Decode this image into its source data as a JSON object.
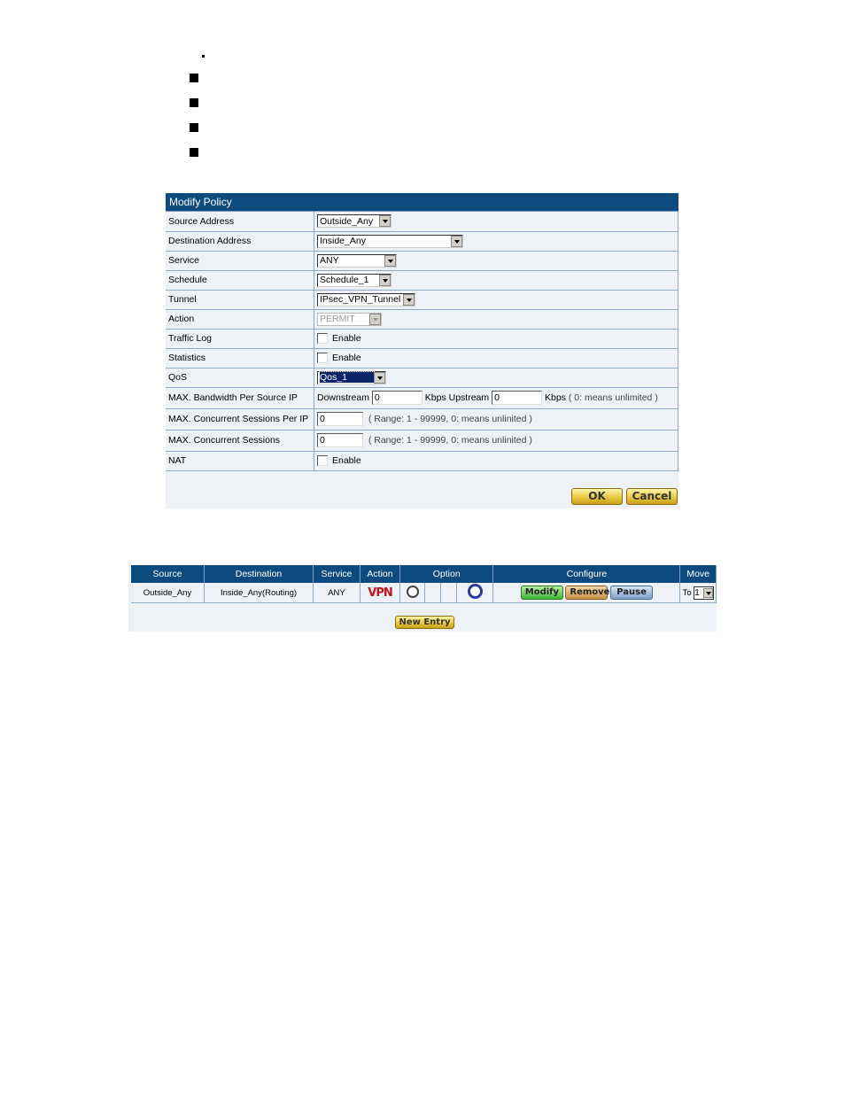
{
  "bullets_count": 4,
  "modify_policy": {
    "title": "Modify Policy",
    "rows": [
      {
        "label": "Source Address",
        "type": "select",
        "value": "Outside_Any"
      },
      {
        "label": "Destination Address",
        "type": "select",
        "value": "Inside_Any"
      },
      {
        "label": "Service",
        "type": "select",
        "value": "ANY"
      },
      {
        "label": "Schedule",
        "type": "select",
        "value": "Schedule_1"
      },
      {
        "label": "Tunnel",
        "type": "select",
        "value": "IPsec_VPN_Tunnel"
      },
      {
        "label": "Action",
        "type": "select",
        "value": "PERMIT",
        "disabled": true
      },
      {
        "label": "Traffic Log",
        "type": "checkbox",
        "value": "Enable",
        "checked": false
      },
      {
        "label": "Statistics",
        "type": "checkbox",
        "value": "Enable",
        "checked": false
      },
      {
        "label": "QoS",
        "type": "select",
        "value": "Qos_1"
      },
      {
        "label": "MAX. Bandwidth Per Source IP"
      },
      {
        "label": "MAX. Concurrent Sessions Per IP",
        "value": "0",
        "hint": "( Range: 1 - 99999, 0: means unlinited )"
      },
      {
        "label": "MAX. Concurrent Sessions",
        "value": "0",
        "hint": "( Range: 1 - 99999, 0: means unlinited )"
      },
      {
        "label": "NAT",
        "type": "checkbox",
        "value": "Enable",
        "checked": false
      }
    ],
    "bandwidth": {
      "downstream_label": "Downstream",
      "downstream_value": "0",
      "upstream_label": "Kbps Upstream",
      "upstream_value": "0",
      "suffix": "Kbps",
      "hint": "( 0: means unlimited )"
    },
    "ok_label": "OK",
    "cancel_label": "Cancel"
  },
  "policy_list": {
    "headers": [
      "Source",
      "Destination",
      "Service",
      "Action",
      "Option",
      "Configure",
      "Move"
    ],
    "row": {
      "source": "Outside_Any",
      "destination": "Inside_Any(Routing)",
      "service": "ANY",
      "action": "VPN",
      "configure": [
        "Modify",
        "Remove",
        "Pause"
      ],
      "move_label": "To",
      "move_value": "1"
    },
    "new_entry_label": "New Entry"
  },
  "colors": {
    "header_bg": "#0d4a7e",
    "panel_bg": "#eef1f6",
    "vpn_red": "#c0141b"
  }
}
